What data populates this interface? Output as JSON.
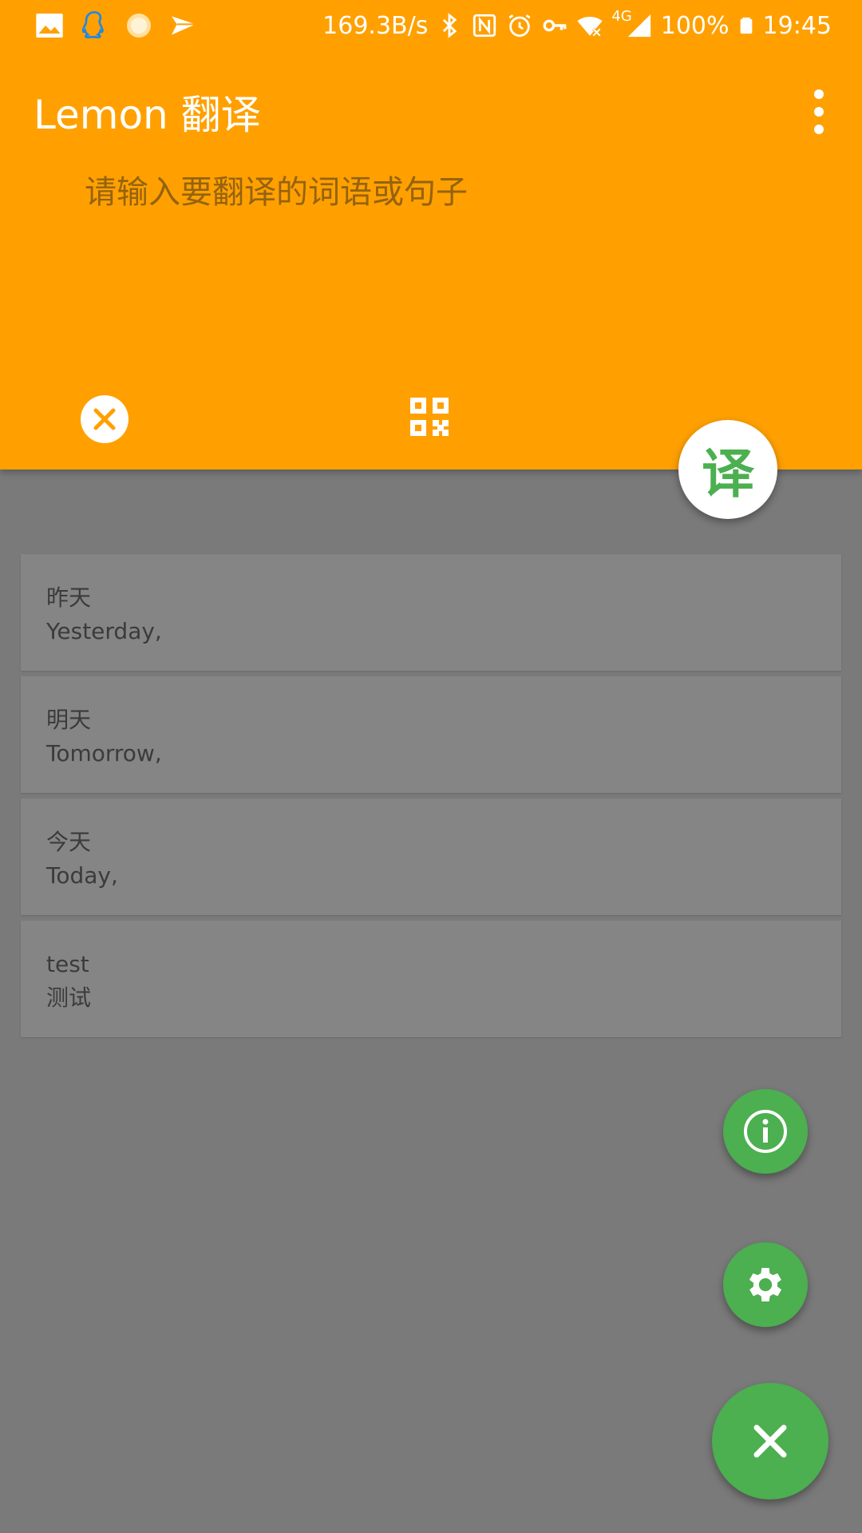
{
  "status_bar": {
    "net_speed": "169.3B/s",
    "network_type": "4G",
    "battery": "100%",
    "time": "19:45",
    "icons_left": [
      "image-icon",
      "qq-icon",
      "weather-icon",
      "send-icon"
    ],
    "icons_right": [
      "bluetooth-icon",
      "nfc-icon",
      "alarm-icon",
      "vpn-key-icon",
      "wifi-off-icon",
      "signal-icon",
      "battery-icon"
    ]
  },
  "toolbar": {
    "title": "Lemon 翻译"
  },
  "input": {
    "placeholder": "请输入要翻译的词语或句子",
    "value": ""
  },
  "translate_button": {
    "label": "译"
  },
  "history": [
    {
      "source": "昨天",
      "translation": "Yesterday,"
    },
    {
      "source": "明天",
      "translation": "Tomorrow,"
    },
    {
      "source": "今天",
      "translation": "Today,"
    },
    {
      "source": "test",
      "translation": "测试"
    }
  ],
  "colors": {
    "header": "#ffa000",
    "fab_green": "#4caf50",
    "scrim": "#7a7a7a",
    "card": "#858585"
  }
}
